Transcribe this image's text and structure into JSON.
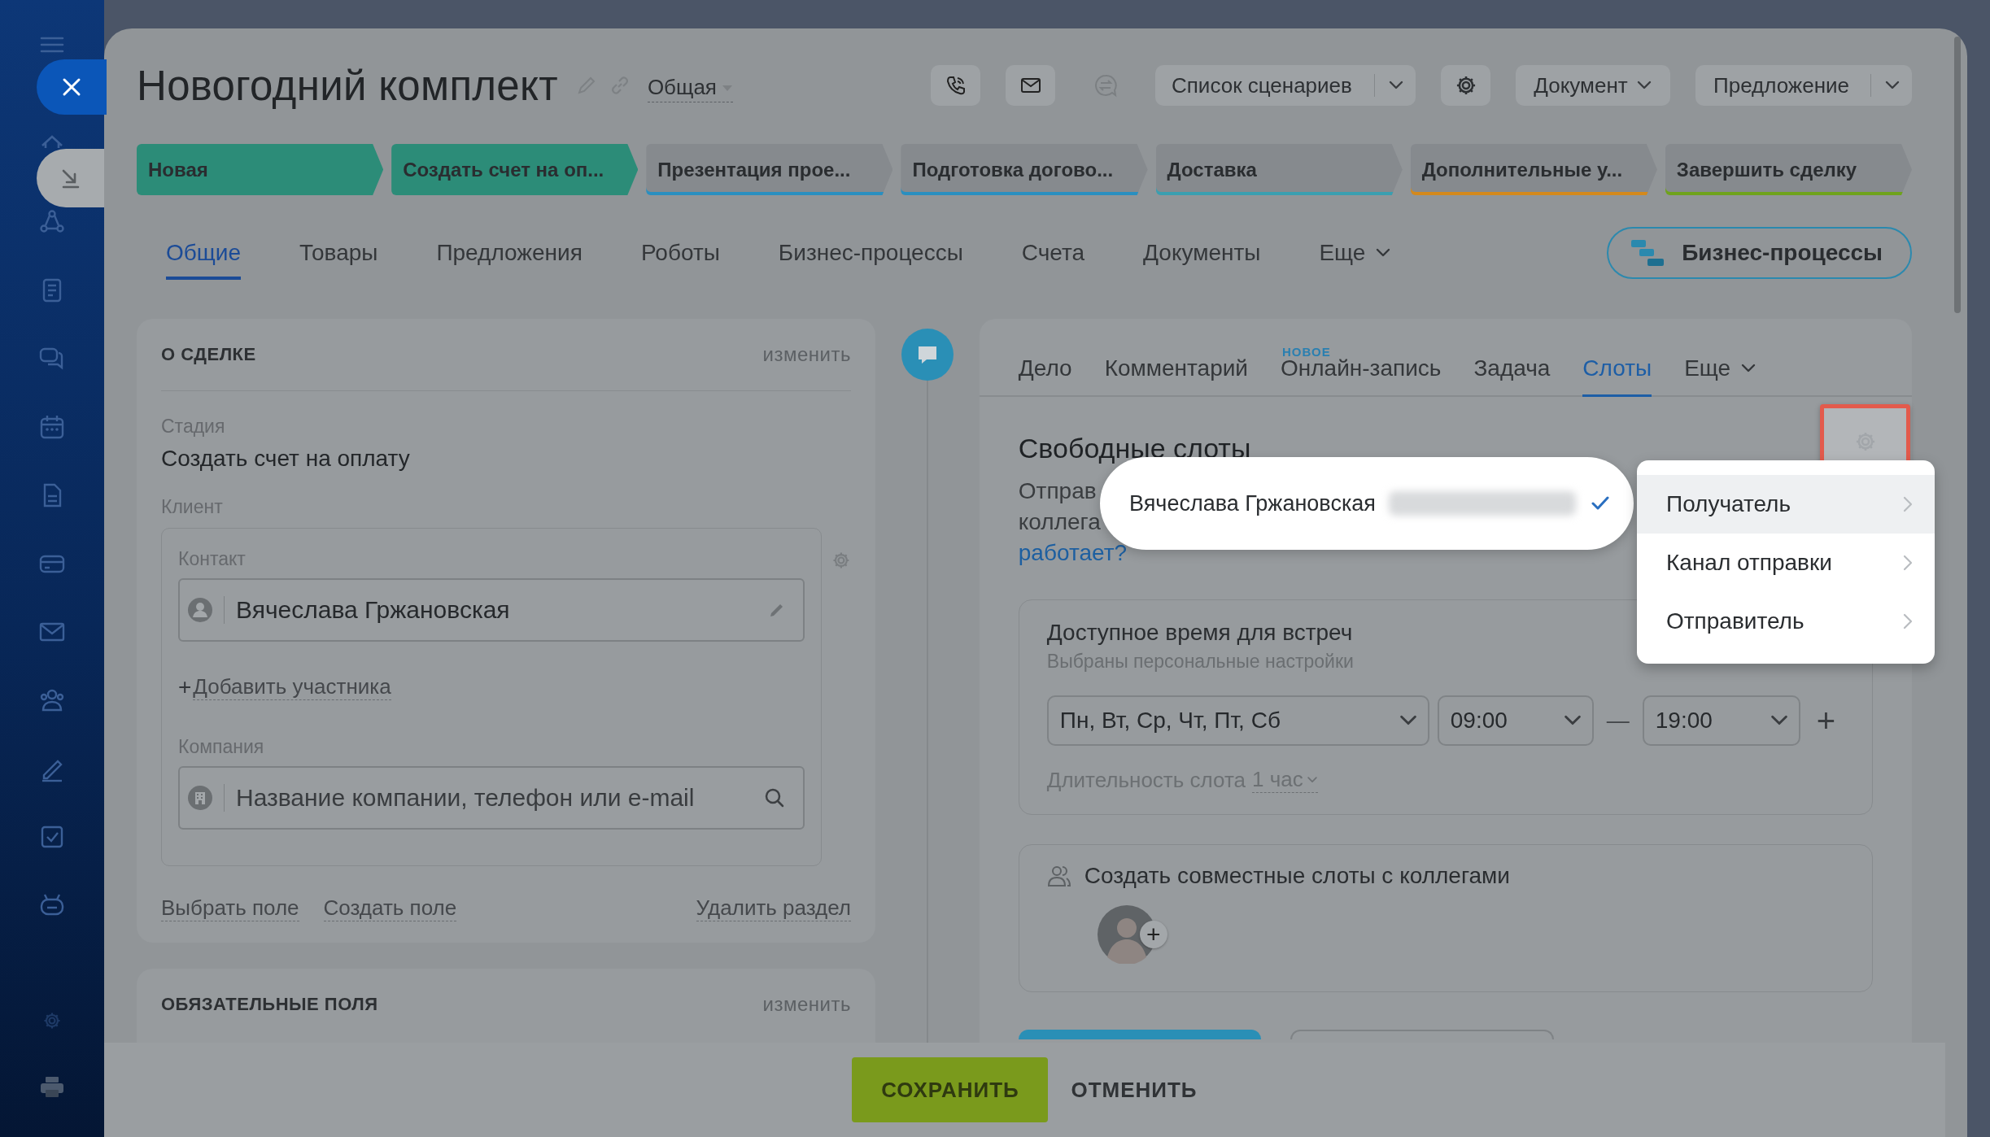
{
  "title": "Новогодний комплект",
  "category": "Общая",
  "toolbar": {
    "scenarios": "Список сценариев",
    "document": "Документ",
    "proposal": "Предложение"
  },
  "stages": [
    {
      "label": "Новая",
      "done": true,
      "color": "#2c8c78"
    },
    {
      "label": "Создать счет на оп...",
      "done": true,
      "color": "#2c8c78"
    },
    {
      "label": "Презентация прое...",
      "done": false,
      "color": "#2a8fc0"
    },
    {
      "label": "Подготовка догово...",
      "done": false,
      "color": "#2a8fc0"
    },
    {
      "label": "Доставка",
      "done": false,
      "color": "#3a9fb0"
    },
    {
      "label": "Дополнительные у...",
      "done": false,
      "color": "#d4891c"
    },
    {
      "label": "Завершить сделку",
      "done": false,
      "color": "#6fa31c"
    }
  ],
  "tabs": [
    {
      "label": "Общие",
      "selected": true,
      "kind": "tab"
    },
    {
      "label": "Товары",
      "selected": false,
      "kind": "tab"
    },
    {
      "label": "Предложения",
      "selected": false,
      "kind": "tab"
    },
    {
      "label": "Роботы",
      "selected": false,
      "kind": "tab"
    },
    {
      "label": "Бизнес-процессы",
      "selected": false,
      "kind": "tab"
    },
    {
      "label": "Счета",
      "selected": false,
      "kind": "tab"
    },
    {
      "label": "Документы",
      "selected": false,
      "kind": "tab"
    },
    {
      "label": "Еще",
      "selected": false,
      "kind": "menu"
    }
  ],
  "bp_button": "Бизнес-процессы",
  "about": {
    "heading": "О СДЕЛКЕ",
    "edit": "изменить",
    "stage_label": "Стадия",
    "stage_value": "Создать счет на оплату",
    "client_label": "Клиент",
    "contact_label": "Контакт",
    "contact_value": "Вячеслава Гржановская",
    "add_sign": "+",
    "add_participant": "Добавить участника",
    "company_label": "Компания",
    "company_placeholder": "Название компании, телефон или e-mail",
    "links": [
      "Выбрать поле",
      "Создать поле"
    ],
    "delete_link": "Удалить раздел"
  },
  "required": {
    "heading": "ОБЯЗАТЕЛЬНЫЕ ПОЛЯ",
    "edit": "изменить"
  },
  "activity": {
    "tabs": [
      {
        "label": "Дело",
        "selected": false,
        "kind": "tab"
      },
      {
        "label": "Комментарий",
        "selected": false,
        "kind": "tab"
      },
      {
        "label": "Онлайн-запись",
        "selected": false,
        "kind": "tab",
        "badge": "НОВОЕ"
      },
      {
        "label": "Задача",
        "selected": false,
        "kind": "tab"
      },
      {
        "label": "Слоты",
        "selected": true,
        "kind": "tab"
      },
      {
        "label": "Еще",
        "selected": false,
        "kind": "menu"
      }
    ],
    "heading": "Свободные слоты",
    "intro": [
      "Отправ",
      "коллега"
    ],
    "help_link": "работает?",
    "hours": {
      "title": "Доступное время для встреч",
      "subtitle": "Выбраны персональные настройки",
      "days": "Пн, Вт, Ср, Чт, Пт, Сб",
      "from": "09:00",
      "dash": "—",
      "to": "19:00",
      "add": "+",
      "duration_label": "Длительность слота",
      "duration_value": "1 час"
    },
    "colleagues": {
      "title": "Создать совместные слоты с коллегами",
      "add": "+"
    }
  },
  "recipient_popup": {
    "name": "Вячеслава Гржановская",
    "checked": true
  },
  "menu": [
    {
      "label": "Получатель",
      "selected": true
    },
    {
      "label": "Канал отправки",
      "selected": false
    },
    {
      "label": "Отправитель",
      "selected": false
    }
  ],
  "footer": {
    "save": "СОХРАНИТЬ",
    "cancel": "ОТМЕНИТЬ"
  }
}
